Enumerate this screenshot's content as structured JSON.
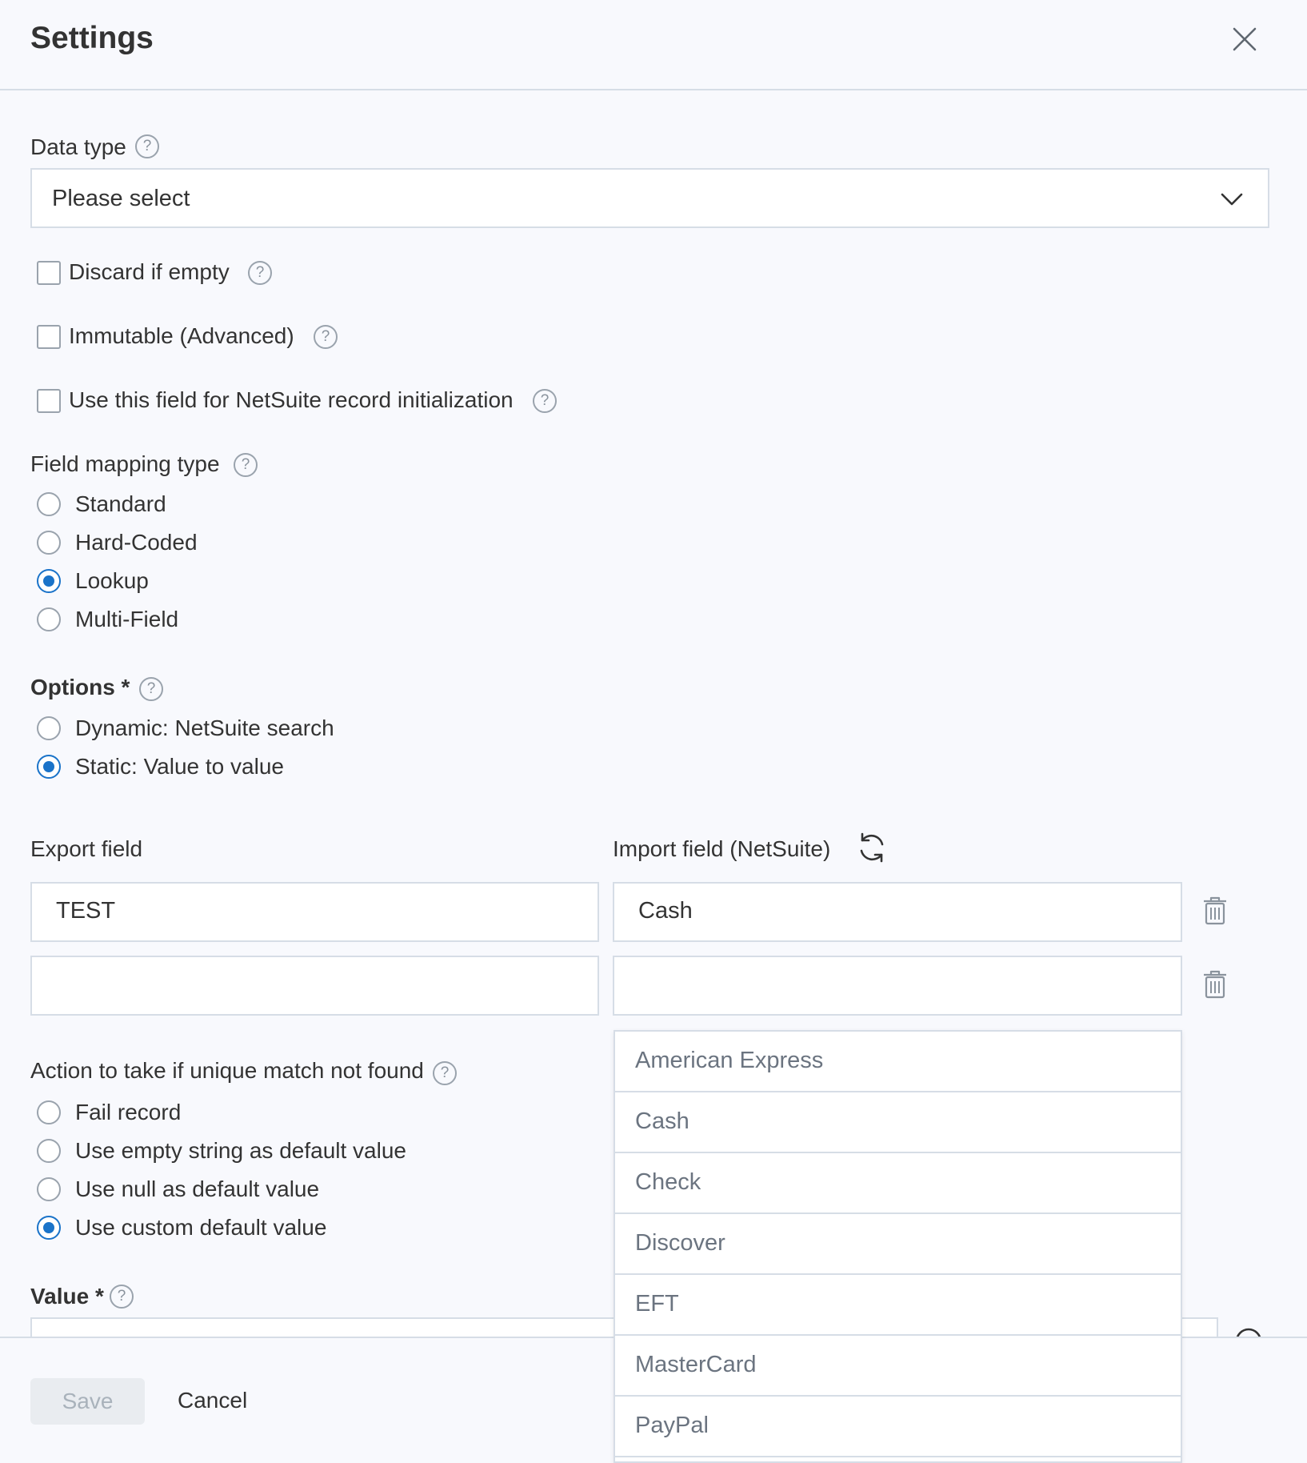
{
  "header": {
    "title": "Settings"
  },
  "data_type": {
    "label": "Data type",
    "value": "Please select"
  },
  "checkboxes": [
    {
      "label": "Discard if empty",
      "checked": false
    },
    {
      "label": "Immutable (Advanced)",
      "checked": false
    },
    {
      "label": "Use this field for NetSuite record initialization",
      "checked": false
    }
  ],
  "field_mapping": {
    "label": "Field mapping type",
    "options": [
      "Standard",
      "Hard-Coded",
      "Lookup",
      "Multi-Field"
    ],
    "selected": "Lookup"
  },
  "options_group": {
    "label": "Options *",
    "options": [
      "Dynamic: NetSuite search",
      "Static: Value to value"
    ],
    "selected": "Static: Value to value"
  },
  "mapping_table": {
    "export_label": "Export field",
    "import_label": "Import field (NetSuite)",
    "rows": [
      {
        "export": "TEST",
        "import": "Cash"
      },
      {
        "export": "",
        "import": ""
      }
    ]
  },
  "import_dropdown": {
    "options": [
      "American Express",
      "Cash",
      "Check",
      "Discover",
      "EFT",
      "MasterCard",
      "PayPal"
    ]
  },
  "action_group": {
    "label": "Action to take if unique match not found",
    "options": [
      "Fail record",
      "Use empty string as default value",
      "Use null as default value",
      "Use custom default value"
    ],
    "selected": "Use custom default value"
  },
  "value_field": {
    "label": "Value *"
  },
  "footer": {
    "save_label": "Save",
    "cancel_label": "Cancel"
  },
  "colors": {
    "accent": "#1a73c9",
    "border": "#d6dde6",
    "background": "#f8f9fd"
  }
}
